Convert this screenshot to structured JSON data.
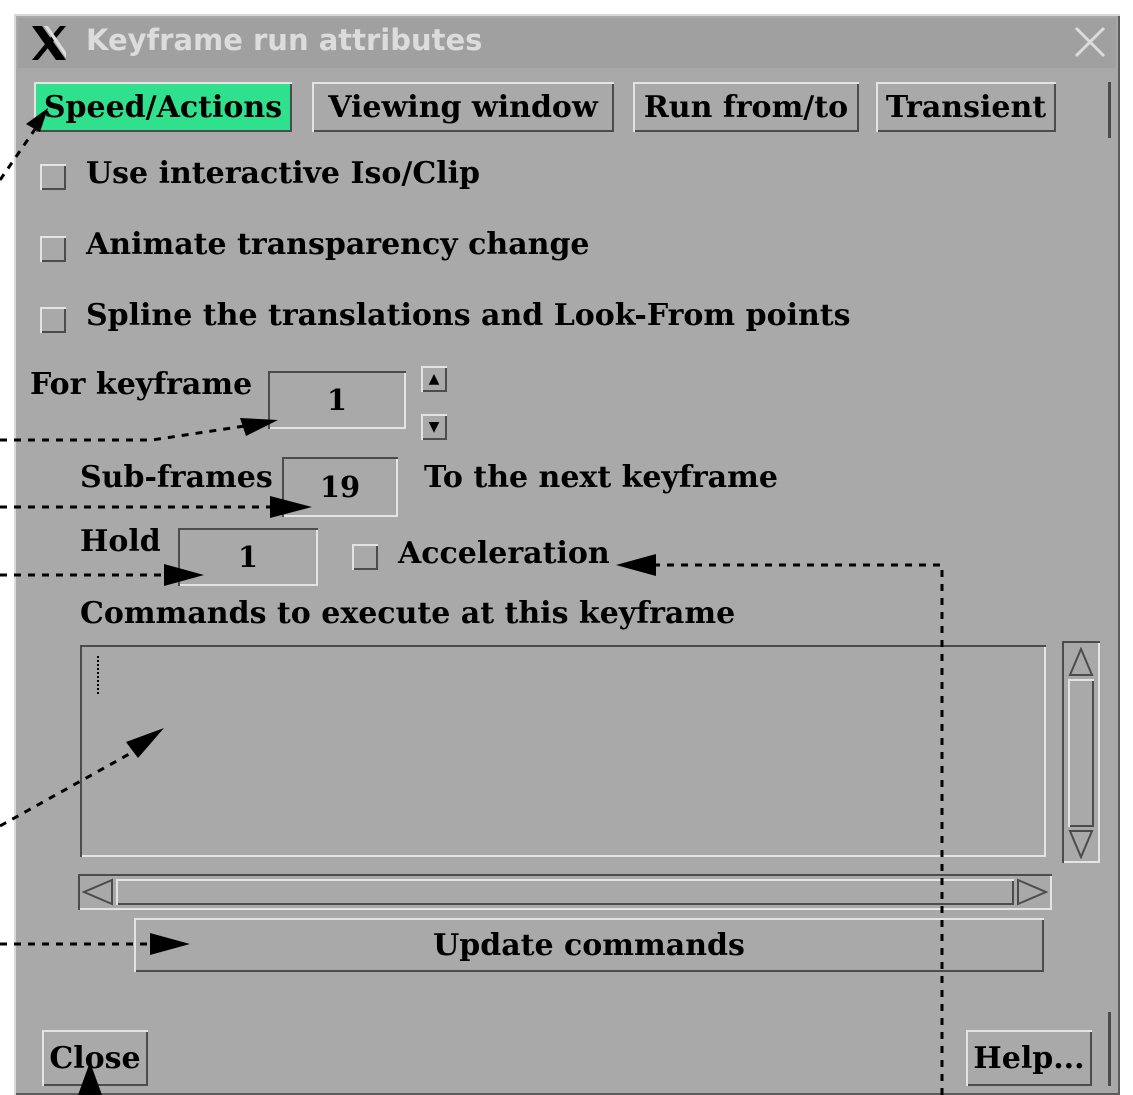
{
  "window": {
    "title": "Keyframe run attributes"
  },
  "tabs": [
    {
      "label": "Speed/Actions",
      "active": true
    },
    {
      "label": "Viewing window",
      "active": false
    },
    {
      "label": "Run from/to",
      "active": false
    },
    {
      "label": "Transient",
      "active": false
    }
  ],
  "options": {
    "interactive_iso_clip": {
      "label": "Use interactive Iso/Clip",
      "checked": false
    },
    "animate_transparency": {
      "label": "Animate transparency change",
      "checked": false
    },
    "spline_translations": {
      "label": "Spline the translations and Look-From points",
      "checked": false
    }
  },
  "keyframe": {
    "label": "For keyframe",
    "value": "1"
  },
  "subframes": {
    "label": "Sub-frames",
    "value": "19",
    "suffix": "To the next keyframe"
  },
  "hold": {
    "label": "Hold",
    "value": "1"
  },
  "acceleration": {
    "label": "Acceleration",
    "checked": false
  },
  "commands": {
    "label": "Commands to execute at this keyframe",
    "text": ""
  },
  "buttons": {
    "update": "Update commands",
    "close": "Close",
    "help": "Help..."
  },
  "colors": {
    "active_tab": "#2fe08c",
    "panel": "#a9a9a9"
  }
}
